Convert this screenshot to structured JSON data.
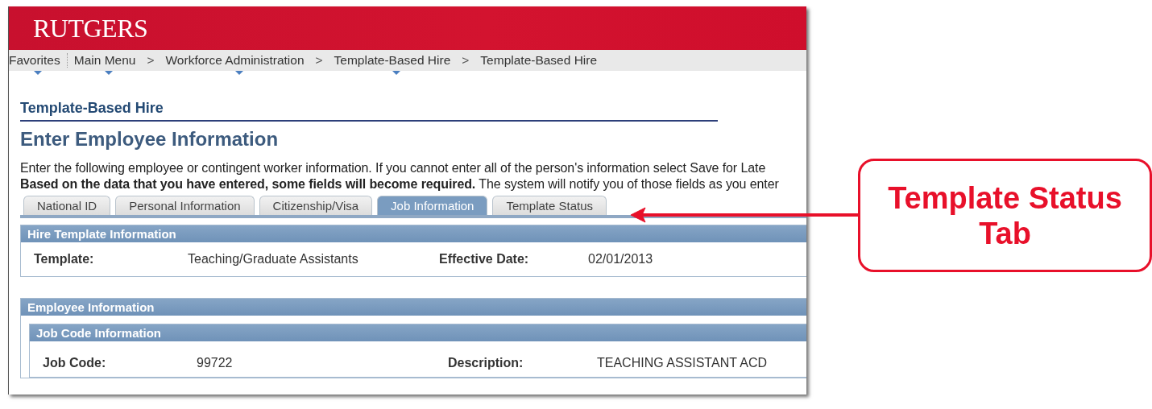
{
  "header": {
    "logo": "RUTGERS"
  },
  "breadcrumbs": [
    {
      "kind": "link",
      "label": "Favorites",
      "menu": true
    },
    {
      "kind": "link",
      "label": "Main Menu",
      "menu": true
    },
    {
      "kind": "separator",
      "label": ">"
    },
    {
      "kind": "link",
      "label": "Workforce Administration",
      "menu": true
    },
    {
      "kind": "separator",
      "label": ">"
    },
    {
      "kind": "link",
      "label": "Template-Based Hire",
      "menu": true
    },
    {
      "kind": "separator",
      "label": ">"
    },
    {
      "kind": "link",
      "label": "Template-Based Hire",
      "menu": false
    }
  ],
  "page": {
    "title": "Template-Based Hire",
    "heading": "Enter Employee Information",
    "instructions": [
      "Enter the following employee or contingent worker information. If you cannot enter all of the person's information select Save for Late",
      "**Based on the data that you have entered, some fields will become required.** The system will notify you of those fields as you enter"
    ]
  },
  "tabs": [
    {
      "label": "National ID",
      "selected": false
    },
    {
      "label": "Personal Information",
      "selected": false
    },
    {
      "label": "Citizenship/Visa",
      "selected": false
    },
    {
      "label": "Job Information",
      "selected": true
    },
    {
      "label": "Template Status",
      "selected": false
    }
  ],
  "sections": [
    {
      "title": "Hire Template Information",
      "fields": [
        {
          "label": "Template:",
          "value": "Teaching/Graduate Assistants"
        },
        {
          "label": "Effective Date:",
          "value": "02/01/2013"
        }
      ]
    },
    {
      "title": "Employee Information",
      "subsections": [
        {
          "title": "Job Code Information",
          "fields": [
            {
              "label": "Job Code:",
              "value": "99722"
            },
            {
              "label": "Description:",
              "value": "TEACHING ASSISTANT ACD"
            }
          ]
        }
      ]
    }
  ],
  "callout": {
    "text": "Template Status Tab"
  }
}
